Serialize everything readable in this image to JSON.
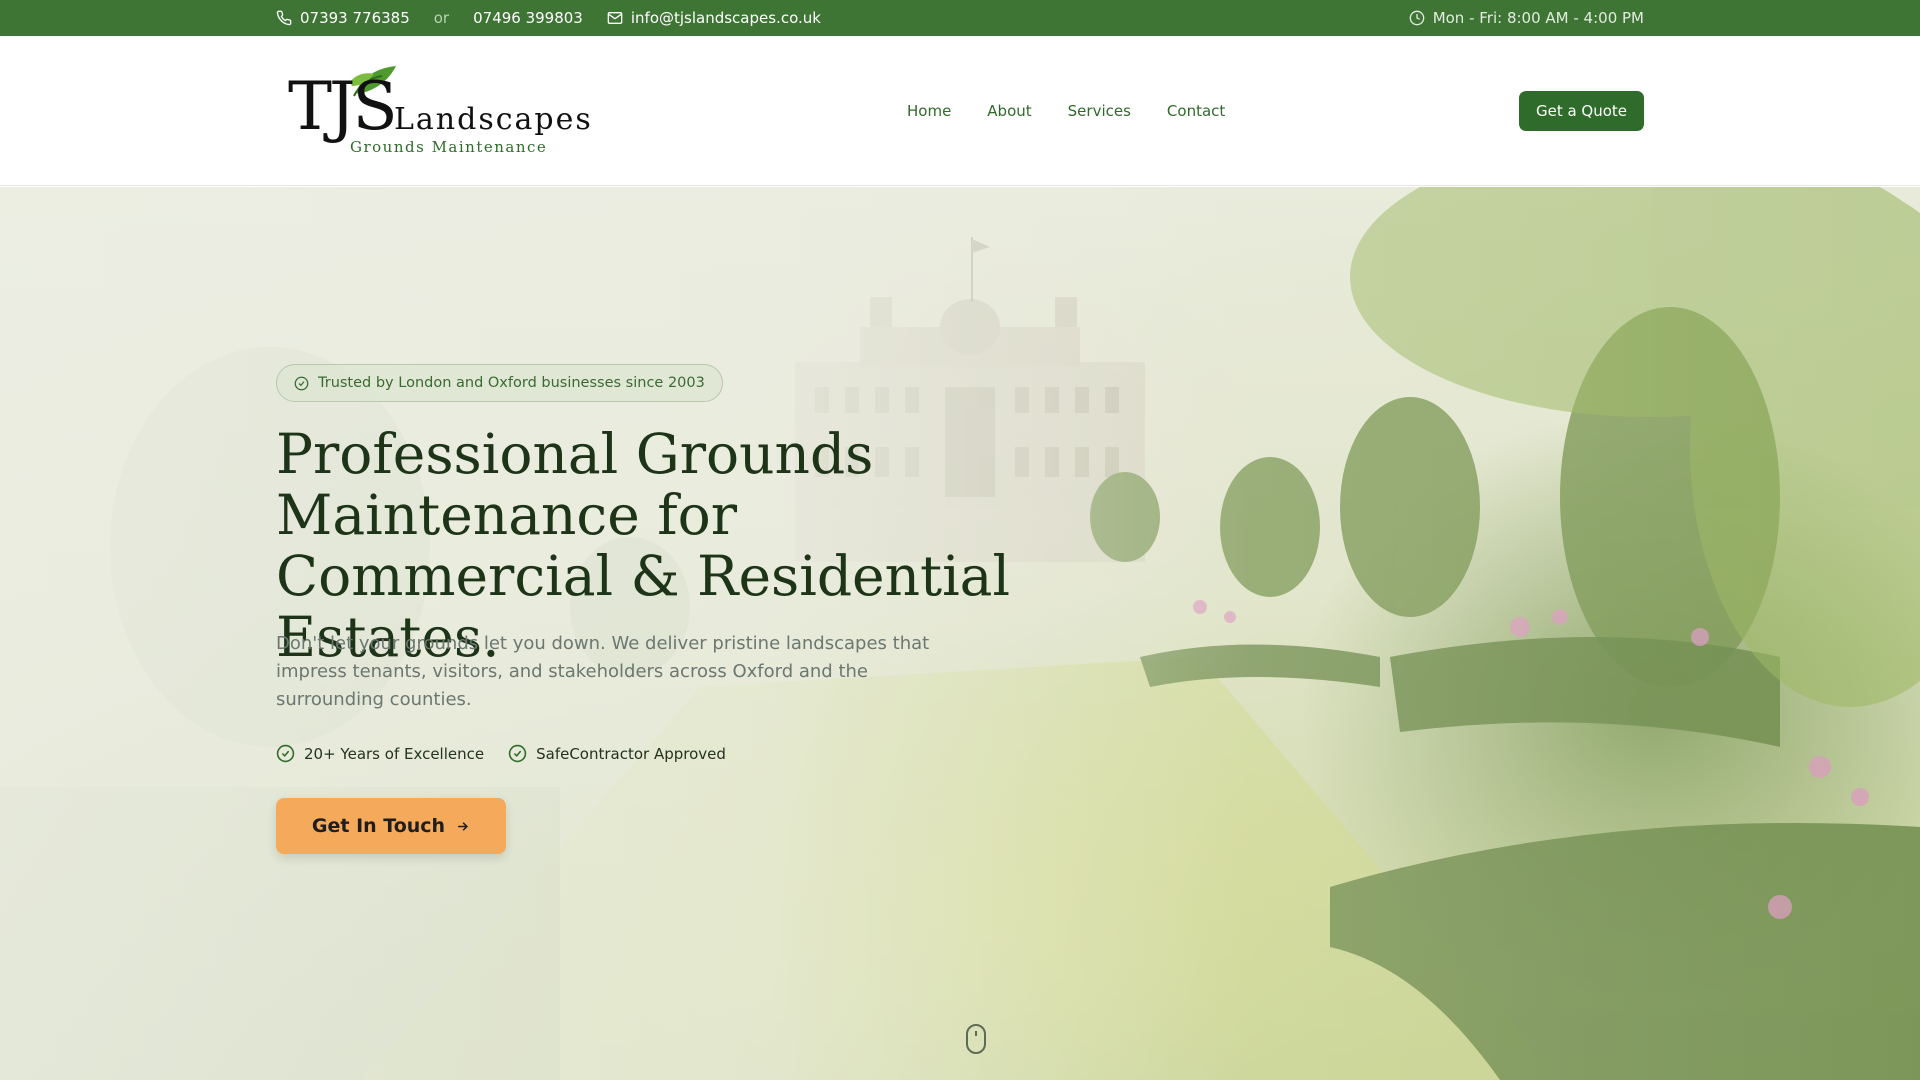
{
  "topbar": {
    "phone_primary": "07393 776385",
    "or_label": "or",
    "phone_secondary": "07496 399803",
    "email": "info@tjslandscapes.co.uk",
    "hours": "Mon - Fri: 8:00 AM - 4:00 PM",
    "icons": {
      "phone": "phone-icon",
      "email": "mail-icon",
      "hours": "clock-icon"
    }
  },
  "header": {
    "logo": {
      "main": "TJS",
      "secondary": "Landscapes",
      "tagline": "Grounds Maintenance"
    },
    "nav": [
      {
        "label": "Home"
      },
      {
        "label": "About"
      },
      {
        "label": "Services"
      },
      {
        "label": "Contact"
      }
    ],
    "quote_button": "Get a Quote"
  },
  "hero": {
    "badge": "Trusted by London and Oxford businesses since 2003",
    "title": "Professional Grounds Maintenance for Commercial & Residential Estates.",
    "description": "Don't let your grounds let you down. We deliver pristine landscapes that impress tenants, visitors, and stakeholders across Oxford and the surrounding counties.",
    "features": [
      {
        "label": "20+ Years of Excellence",
        "icon": "check-circle-icon"
      },
      {
        "label": "SafeContractor Approved",
        "icon": "check-circle-icon"
      }
    ],
    "cta": "Get In Touch",
    "scroll_icon": "mouse-scroll-icon"
  },
  "colors": {
    "primary_green": "#3e7534",
    "dark_green": "#2f6b2a",
    "cta_orange": "#f5a95a",
    "heading": "#1d3418"
  }
}
